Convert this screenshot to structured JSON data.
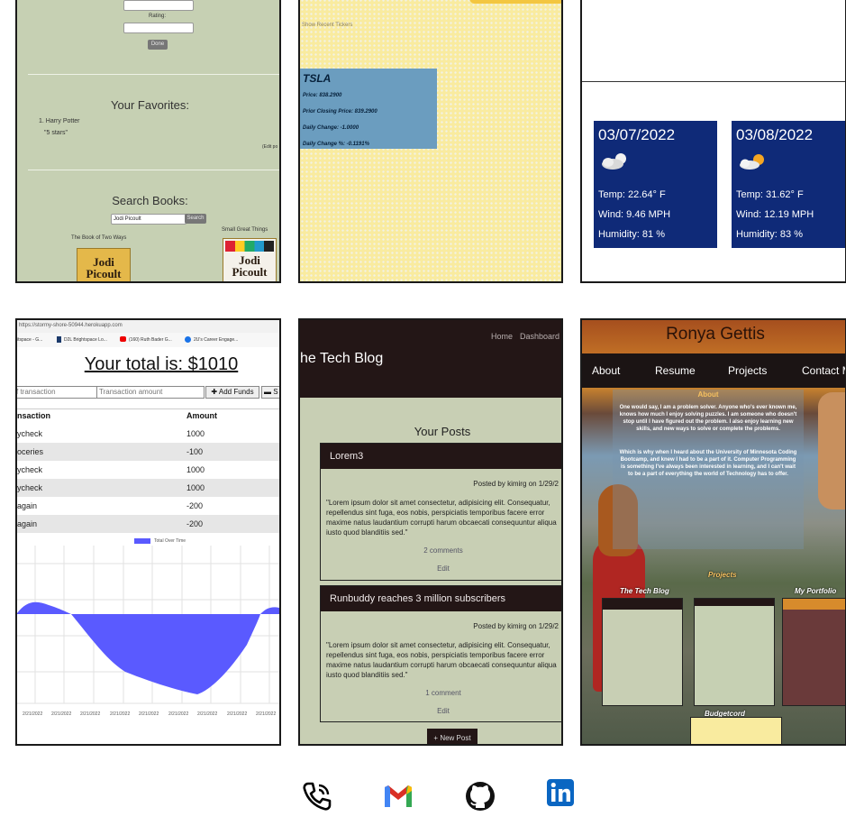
{
  "books_app": {
    "rating_label": "Rating:",
    "done_button": "Done",
    "favorites_heading": "Your Favorites:",
    "favorite_item_1": "1. Harry Potter",
    "favorite_item_1_rating": "\"5 stars\"",
    "edge_fragment": "(Edit po",
    "search_heading": "Search Books:",
    "search_value": "Jodi Picoult",
    "search_button": "Search",
    "results": [
      {
        "title": "The Book of Two Ways",
        "author": "Jodi Picoult"
      },
      {
        "title": "Small Great Things",
        "author": "Jodi Picoult"
      }
    ]
  },
  "stock_app": {
    "recent_label": "Show Recent Tickers",
    "card": {
      "symbol": "TSLA",
      "price": "Price: 838.2900",
      "prior_close": "Prior Closing Price: 839.2900",
      "daily_change": "Daily Change: -1.0000",
      "daily_change_pct": "Daily Change %: -0.1191%"
    }
  },
  "weather_app": {
    "forecast": [
      {
        "date": "03/07/2022",
        "icon": "cloudy-night-icon",
        "temp": "Temp: 22.64° F",
        "wind": "Wind: 9.46 MPH",
        "humidity": "Humidity: 81 %"
      },
      {
        "date": "03/08/2022",
        "icon": "partly-sunny-icon",
        "temp": "Temp: 31.62° F",
        "wind": "Wind: 12.19 MPH",
        "humidity": "Humidity: 83 %"
      }
    ]
  },
  "budget_app": {
    "url": "https://stormy-shore-50944.herokuapp.com",
    "bookmarks": [
      "itspace - G...",
      "D2L Brightspace Lo...",
      "(160) Ruth Bader G...",
      "2U's Career Engage..."
    ],
    "total_heading": "Your total is: $1010",
    "name_placeholder": "f transaction",
    "amount_placeholder": "Transaction amount",
    "add_funds": "✚ Add Funds",
    "subtract": "▬ S",
    "col_transaction": "nsaction",
    "col_amount": "Amount",
    "rows": [
      {
        "name": "ycheck",
        "amount": "1000"
      },
      {
        "name": "oceries",
        "amount": "-100"
      },
      {
        "name": "ycheck",
        "amount": "1000"
      },
      {
        "name": "ycheck",
        "amount": "1000"
      },
      {
        "name": "again",
        "amount": "-200"
      },
      {
        "name": "again",
        "amount": "-200"
      }
    ],
    "legend": "Total Over Time",
    "x_ticks": [
      "2/21/2022",
      "2/21/2022",
      "2/21/2022",
      "2/21/2022",
      "2/21/2022",
      "2/21/2022",
      "2/21/2022",
      "2/21/2022",
      "2/21/2022"
    ]
  },
  "tech_blog": {
    "nav_home": "Home",
    "nav_dashboard": "Dashboard",
    "site_title": "he Tech Blog",
    "section_title": "Your Posts",
    "posts": [
      {
        "title": "Lorem3",
        "meta": "Posted by kimirg on 1/29/2",
        "body": "\"Lorem ipsum dolor sit amet consectetur, adipisicing elit. Consequatur, repellendus sint fuga, eos nobis, perspiciatis temporibus facere error maxime natus laudantium corrupti harum obcaecati consequuntur aliqua iusto quod blanditiis sed.\"",
        "comments": "2 comments",
        "edit": "Edit"
      },
      {
        "title": "Runbuddy reaches 3 million subscribers",
        "meta": "Posted by kimirg on 1/29/2",
        "body": "\"Lorem ipsum dolor sit amet consectetur, adipisicing elit. Consequatur, repellendus sint fuga, eos nobis, perspiciatis temporibus facere error maxime natus laudantium corrupti harum obcaecati consequuntur aliqua iusto quod blanditiis sed.\"",
        "comments": "1 comment",
        "edit": "Edit"
      }
    ],
    "new_post": "+ New Post"
  },
  "portfolio": {
    "name": "Ronya Gettis",
    "nav": [
      "About",
      "Resume",
      "Projects",
      "Contact M"
    ],
    "about_heading": "About",
    "about_p1": "One would say, I am a problem solver. Anyone who's ever known me, knows how much I enjoy solving puzzles. I am someone who doesn't stop until I have figured out the problem. I also enjoy learning new skills, and new ways to solve or complete the problems.",
    "about_p2": "Which is why when I heard about the University of Minnesota Coding Bootcamp, and knew I had to be a part of it. Computer Programming is something I've always been interested in learning, and I can't wait to be a part of everything the world of Technology has to offer.",
    "projects_heading": "Projects",
    "project_titles": [
      "The Tech Blog",
      "My Portfolio",
      "Budgetcord"
    ]
  },
  "contact_icons": [
    "phone-icon",
    "gmail-icon",
    "github-icon",
    "linkedin-icon"
  ],
  "colors": {
    "weather_card": "#0f2a78",
    "blog_dark": "#231616",
    "stock_card": "#6b9dbf",
    "chart_fill": "#5a5aff",
    "gmail_red": "#d93025",
    "linkedin_blue": "#0a66c2"
  }
}
